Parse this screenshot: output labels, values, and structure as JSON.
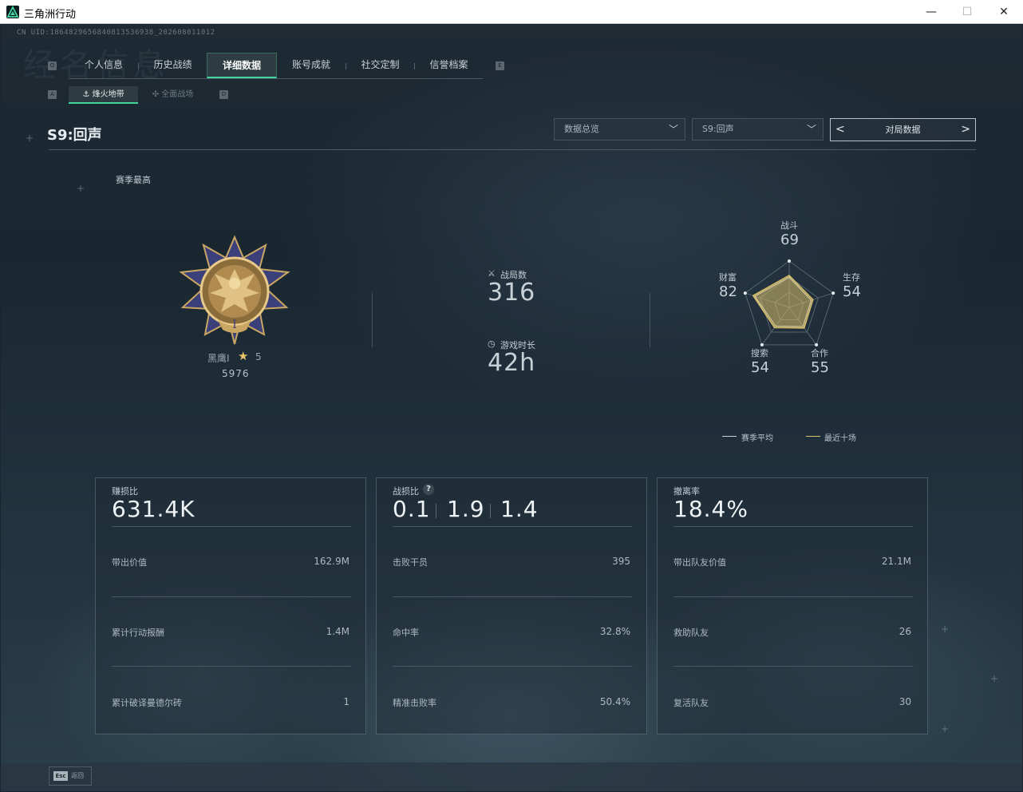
{
  "window": {
    "title": "三角洲行动",
    "minimize": "—",
    "maximize": "☐",
    "close": "✕"
  },
  "uid": "CN UID:1864829656840813536938_202608011012",
  "bg_title": "经名信息",
  "tabs": {
    "left_key": "Q",
    "right_key": "E",
    "items": [
      "个人信息",
      "历史战绩",
      "详细数据",
      "账号成就",
      "社交定制",
      "信誉档案"
    ],
    "active_index": 2
  },
  "subtabs": {
    "left_key": "A",
    "right_key": "D",
    "items": [
      "烽火地带",
      "全面战场"
    ],
    "active_index": 0
  },
  "header": {
    "season_title": "S9:回声",
    "dropdown_overview": "数据总览",
    "dropdown_season": "S9:回声",
    "page_switch_label": "对局数据"
  },
  "season_best": {
    "label": "赛季最高",
    "rank_name": "黑鹰I",
    "rank_stars": "5",
    "score": "5976",
    "medal_numeral": "I"
  },
  "stats": {
    "matches_label": "战局数",
    "matches_value": "316",
    "playtime_label": "游戏时长",
    "playtime_value": "42h"
  },
  "radar": {
    "axes": [
      {
        "label": "战斗",
        "value": "69"
      },
      {
        "label": "生存",
        "value": "54"
      },
      {
        "label": "合作",
        "value": "55"
      },
      {
        "label": "搜索",
        "value": "54"
      },
      {
        "label": "财富",
        "value": "82"
      }
    ],
    "legend_season_avg": "赛季平均",
    "legend_recent_ten": "最近十场",
    "color_season_avg": "#c9d2d7",
    "color_recent_ten": "#d9bf6a"
  },
  "cards": [
    {
      "label": "赚损比",
      "big": "631.4K",
      "rows": [
        {
          "label": "带出价值",
          "value": "162.9M"
        },
        {
          "label": "累计行动报酬",
          "value": "1.4M"
        },
        {
          "label": "累计破译曼德尔砖",
          "value": "1"
        }
      ]
    },
    {
      "label": "战损比",
      "help": "?",
      "big_parts": [
        "0.1",
        "1.9",
        "1.4"
      ],
      "rows": [
        {
          "label": "击败干员",
          "value": "395"
        },
        {
          "label": "命中率",
          "value": "32.8%"
        },
        {
          "label": "精准击败率",
          "value": "50.4%"
        }
      ]
    },
    {
      "label": "撤离率",
      "big": "18.4%",
      "rows": [
        {
          "label": "带出队友价值",
          "value": "21.1M"
        },
        {
          "label": "救助队友",
          "value": "26"
        },
        {
          "label": "复活队友",
          "value": "30"
        }
      ]
    }
  ],
  "footer": {
    "esc_key": "Esc",
    "back_label": "返回"
  },
  "colors": {
    "accent": "#3fd59c",
    "gold": "#e8c46a"
  }
}
